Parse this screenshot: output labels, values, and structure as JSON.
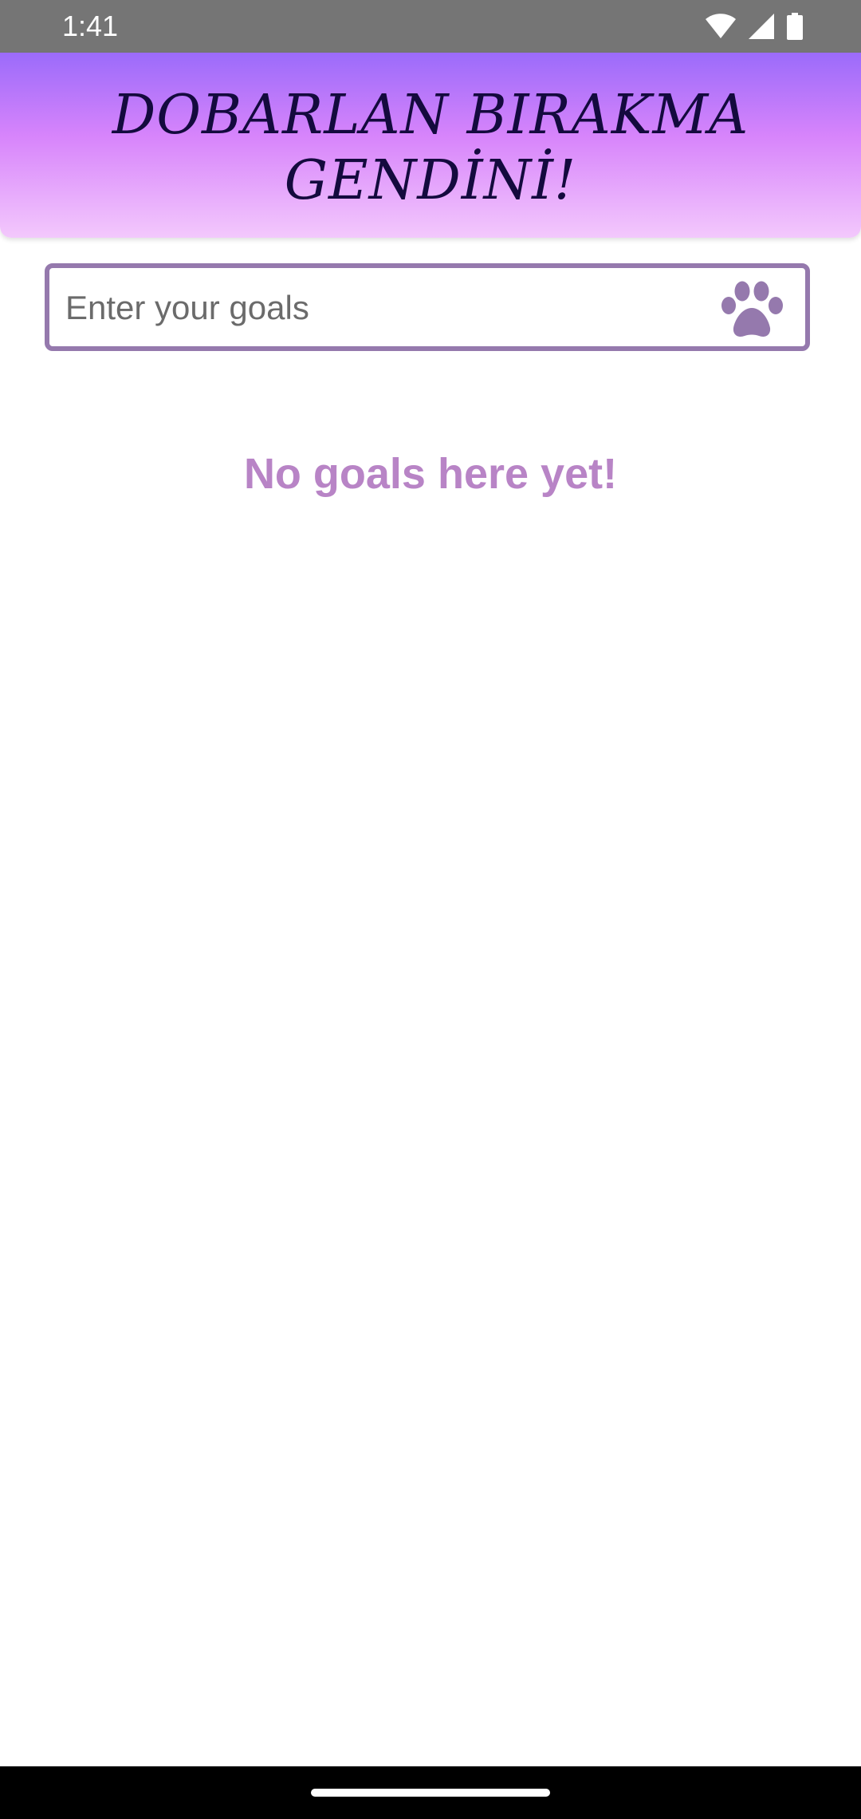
{
  "status_bar": {
    "time": "1:41",
    "icons": [
      "wifi-icon",
      "cellular-signal-icon",
      "battery-icon"
    ]
  },
  "header": {
    "title_line1": "DOBARLAN BIRAKMA",
    "title_line2": "GENDİNİ!"
  },
  "goal_input": {
    "placeholder": "Enter your goals",
    "value": "",
    "button_icon": "paw-icon"
  },
  "goals_list": {
    "items": [],
    "empty_text": "No goals here yet!"
  },
  "colors": {
    "header_gradient_top": "#9b6bfa",
    "header_gradient_mid": "#d784fb",
    "header_gradient_bottom": "#f3c8fc",
    "title_text": "#140a3e",
    "input_border": "#9579ad",
    "paw_icon": "#9579ad",
    "empty_text": "#b884c6"
  }
}
